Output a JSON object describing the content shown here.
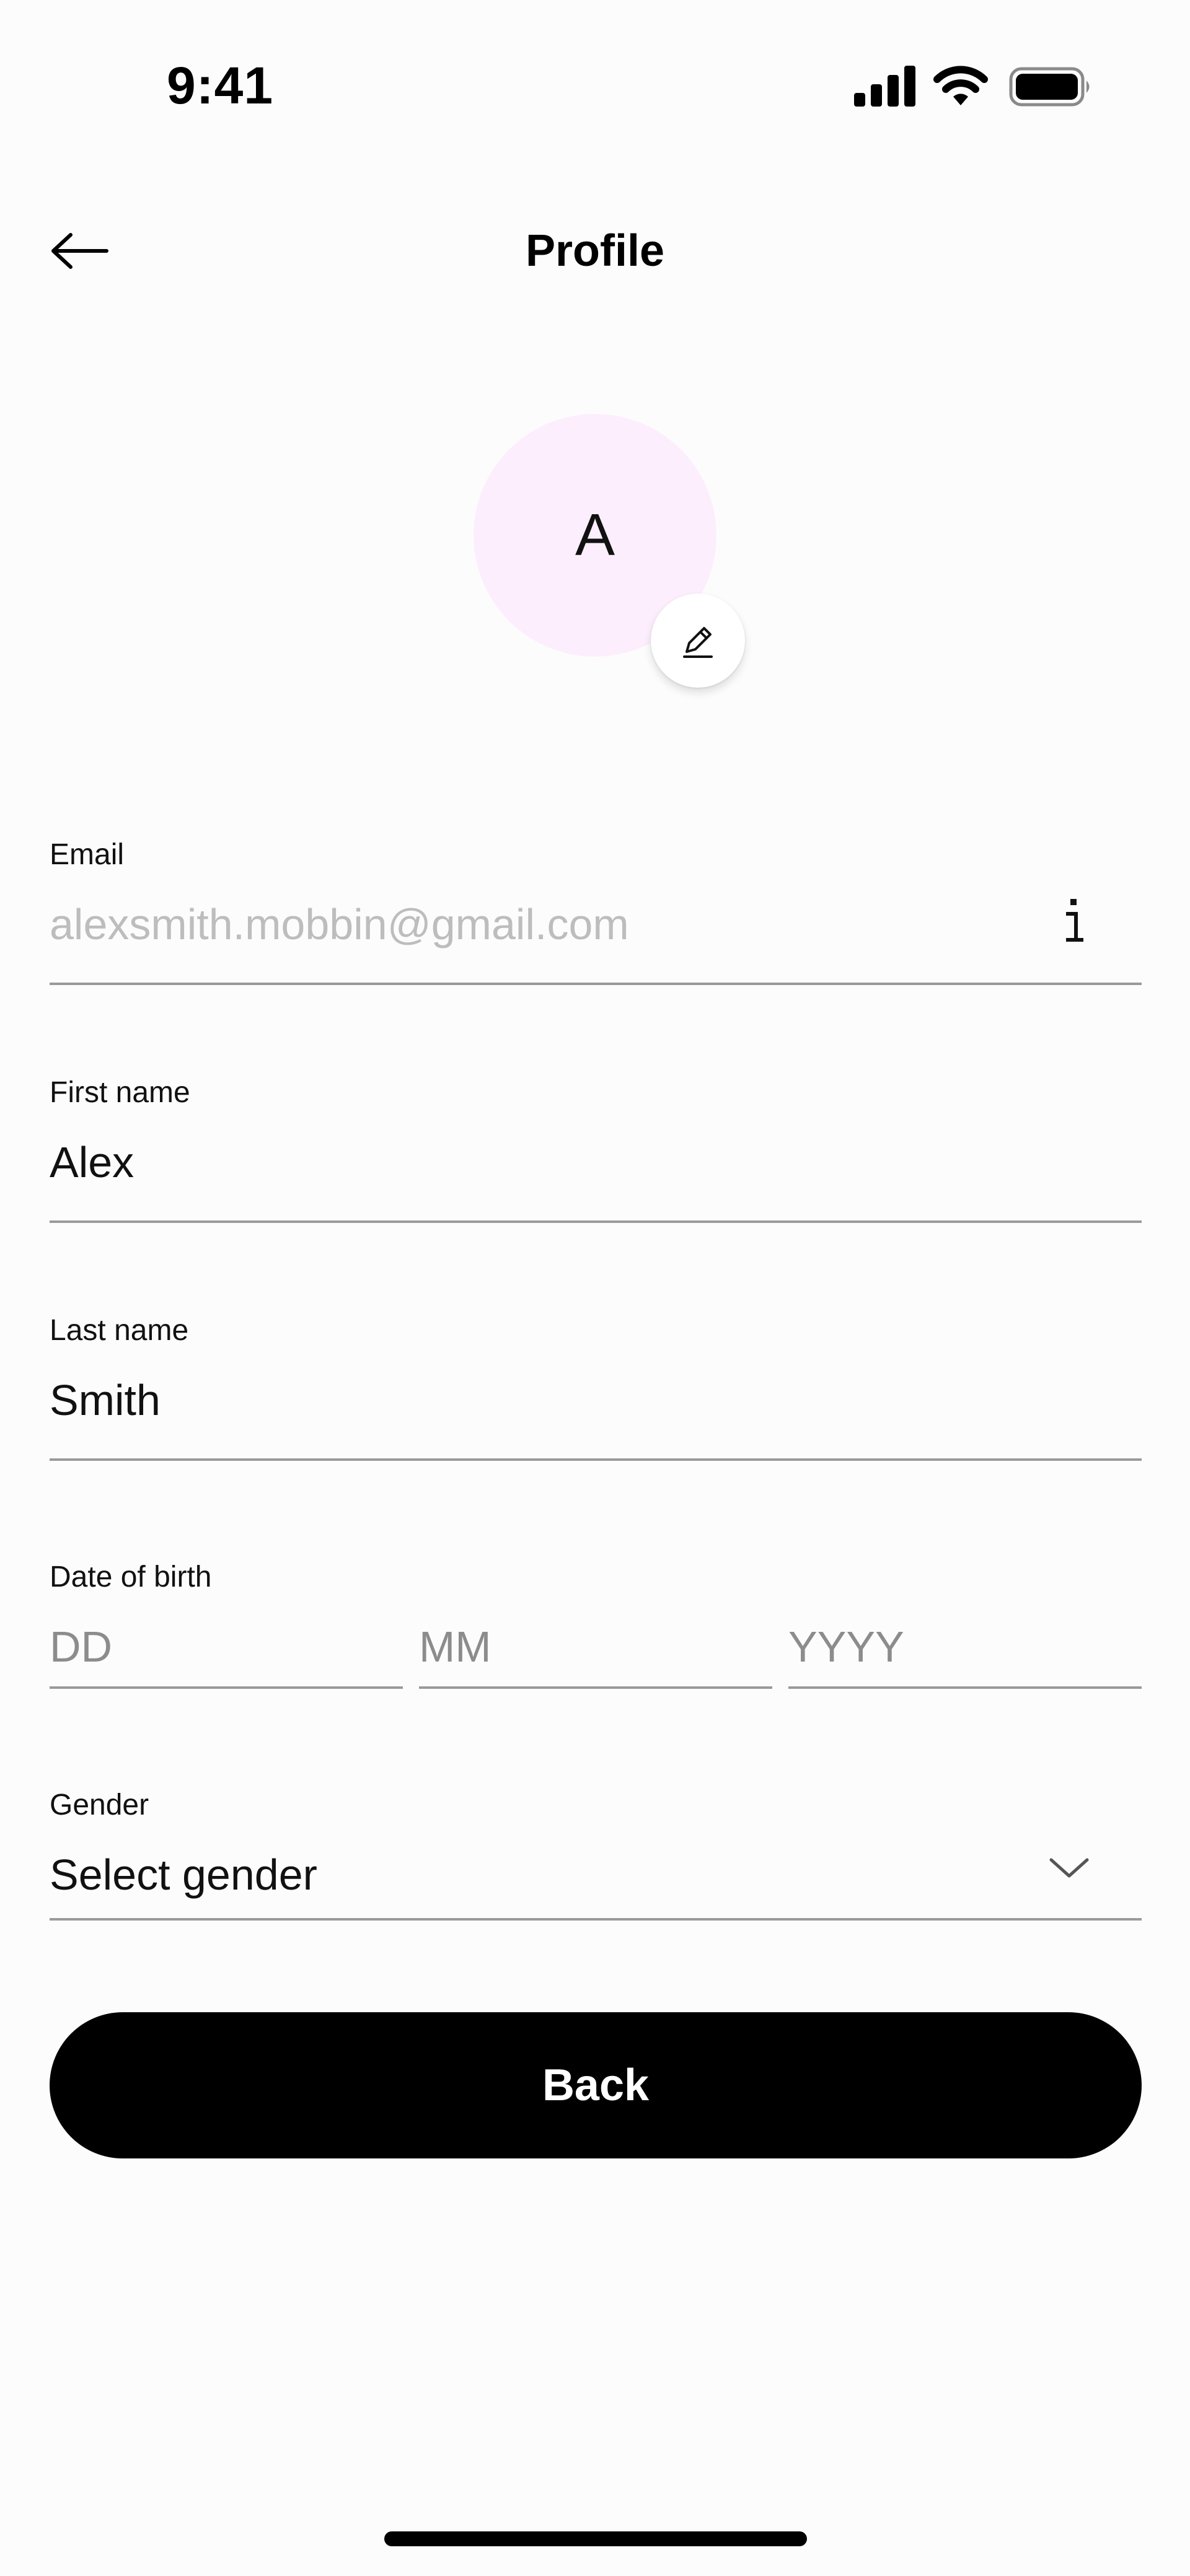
{
  "status_bar": {
    "time": "9:41",
    "icons": [
      "signal-icon",
      "wifi-icon",
      "battery-icon"
    ]
  },
  "header": {
    "title": "Profile",
    "back_icon": "back-arrow-icon"
  },
  "avatar": {
    "initial": "A",
    "background": "#fdeefd",
    "edit_icon": "pencil-icon"
  },
  "form": {
    "email": {
      "label": "Email",
      "value": "alexsmith.mobbin@gmail.com",
      "icon": "info-icon"
    },
    "first_name": {
      "label": "First name",
      "value": "Alex"
    },
    "last_name": {
      "label": "Last name",
      "value": "Smith"
    },
    "date_of_birth": {
      "label": "Date of birth",
      "day_placeholder": "DD",
      "month_placeholder": "MM",
      "year_placeholder": "YYYY"
    },
    "gender": {
      "label": "Gender",
      "selected": "Select gender",
      "icon": "chevron-down-icon"
    }
  },
  "actions": {
    "back_label": "Back"
  },
  "colors": {
    "background": "#fdfcfd",
    "button": "#000000",
    "button_text": "#ffffff",
    "underline": "#9a9a9a",
    "disabled_text": "#bdbdbd",
    "placeholder_text": "#8c8c8c"
  }
}
